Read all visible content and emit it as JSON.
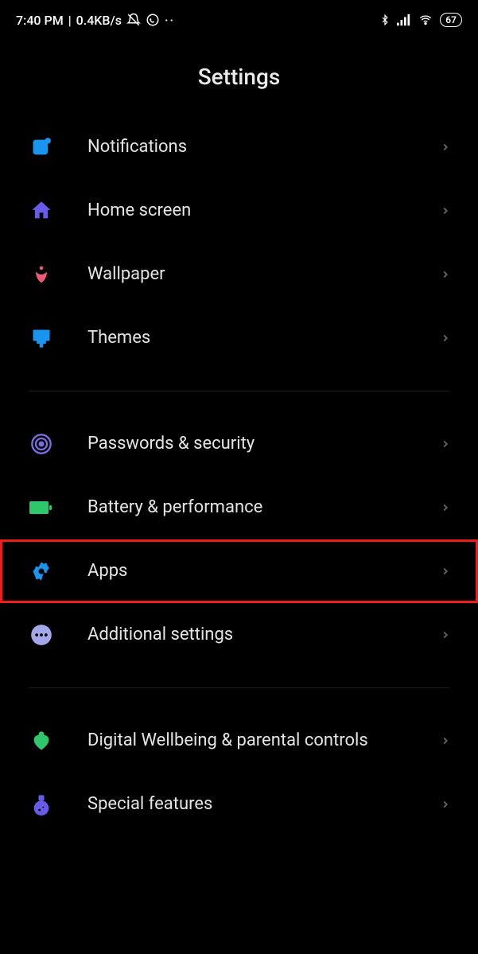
{
  "status": {
    "time": "7:40 PM",
    "net_speed": "0.4KB/s",
    "battery": "67"
  },
  "title": "Settings",
  "rows": {
    "notifications": "Notifications",
    "home_screen": "Home screen",
    "wallpaper": "Wallpaper",
    "themes": "Themes",
    "passwords_security": "Passwords & security",
    "battery_performance": "Battery & performance",
    "apps": "Apps",
    "additional_settings": "Additional settings",
    "digital_wellbeing": "Digital Wellbeing & parental controls",
    "special_features": "Special features"
  },
  "colors": {
    "notifications": "#1a95ef",
    "home_screen": "#675be8",
    "wallpaper": "#ea5a76",
    "themes": "#1a95ef",
    "passwords_security": "#7a6de0",
    "battery_performance": "#2ec76b",
    "apps": "#1a95ef",
    "additional_settings": "#a3a8ea",
    "digital_wellbeing": "#2ec76b",
    "special_features": "#675be8"
  }
}
